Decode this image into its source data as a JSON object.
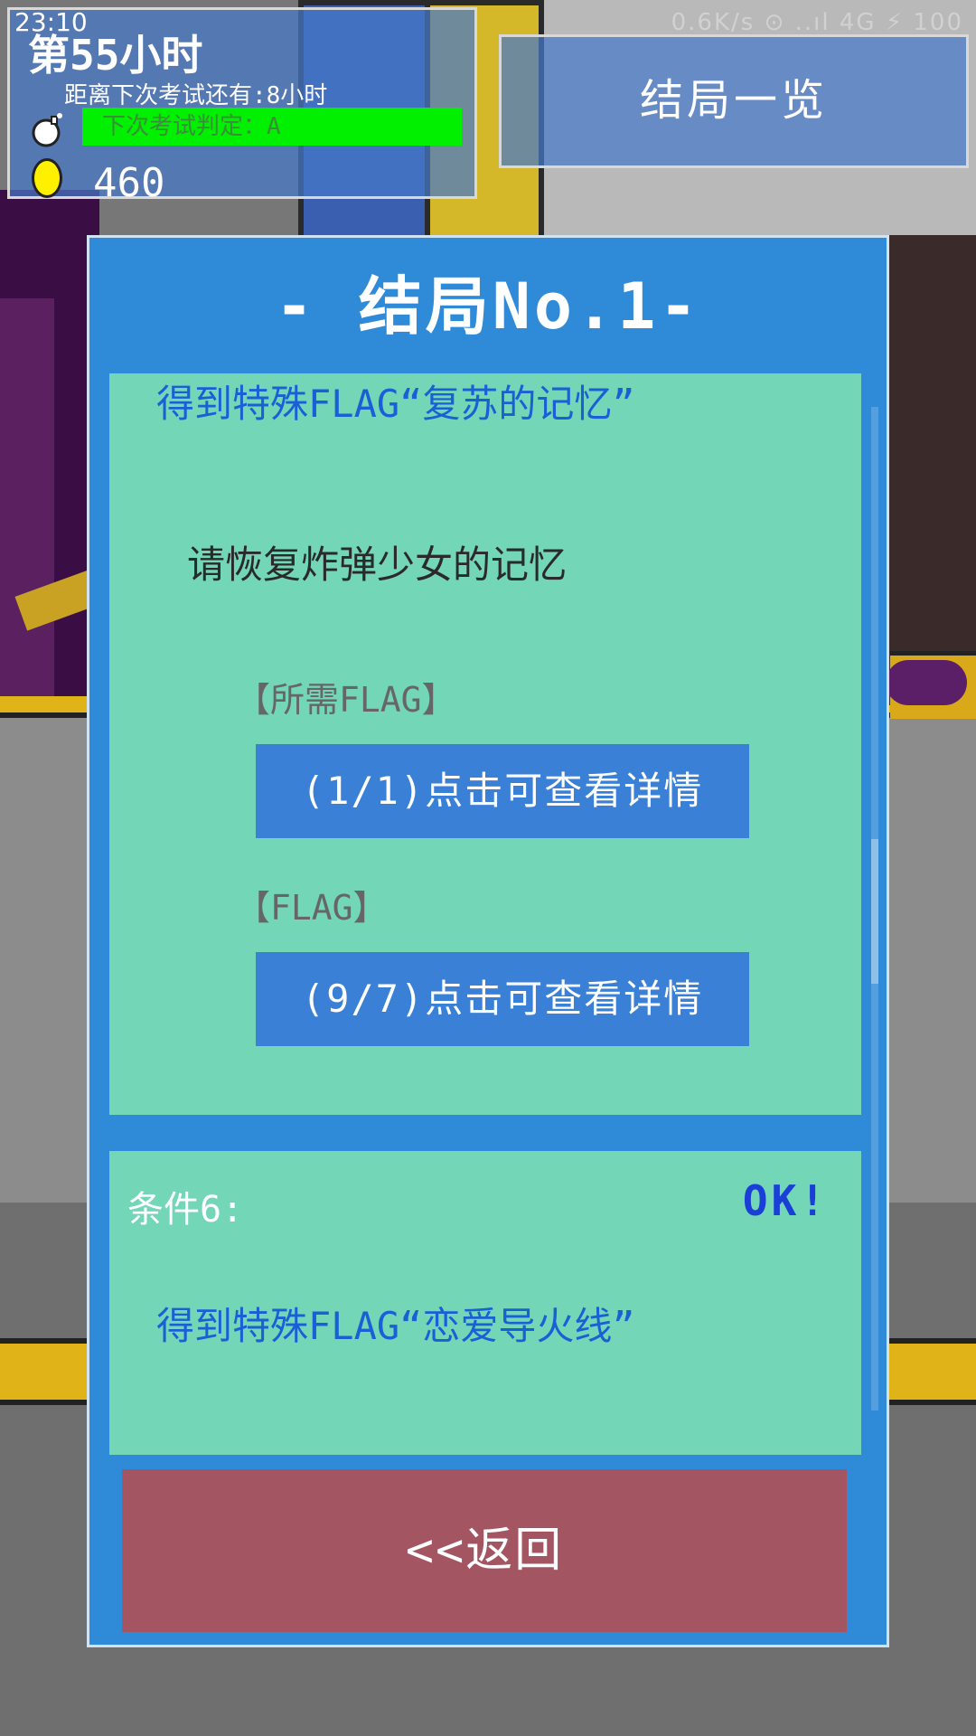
{
  "status_bar": {
    "time": "23:10",
    "network": "0.6K/s ⊙ ..ıl 4G ⚡ 100"
  },
  "hud": {
    "hour": "第55小时",
    "countdown": "距离下次考试还有:8小时",
    "exam_grade": "下次考试判定：A",
    "coins": "460",
    "bomb_icon": "bomb-icon",
    "coin_icon": "coin-icon"
  },
  "ending_list_button": "结局一览",
  "modal": {
    "title": "- 结局No.1-",
    "card1": {
      "flag_line": "得到特殊FLAG“复苏的记忆”",
      "description": "请恢复炸弹少女的记忆",
      "required_flag_label": "【所需FLAG】",
      "required_flag_button": "(1/1)点击可查看详情",
      "flag_label": "【FLAG】",
      "flag_button": "(9/7)点击可查看详情"
    },
    "card2": {
      "condition": "条件6:",
      "status": "OK!",
      "flag_line": "得到特殊FLAG“恋爱导火线”"
    },
    "back_button": "<<返回"
  },
  "colors": {
    "modal_bg": "#2f8ad8",
    "card_bg": "#73d6b6",
    "button_blue": "#3a80d6",
    "back_button": "#a35562",
    "exam_bar": "#00f000",
    "flag_text": "#1a5fd6"
  }
}
